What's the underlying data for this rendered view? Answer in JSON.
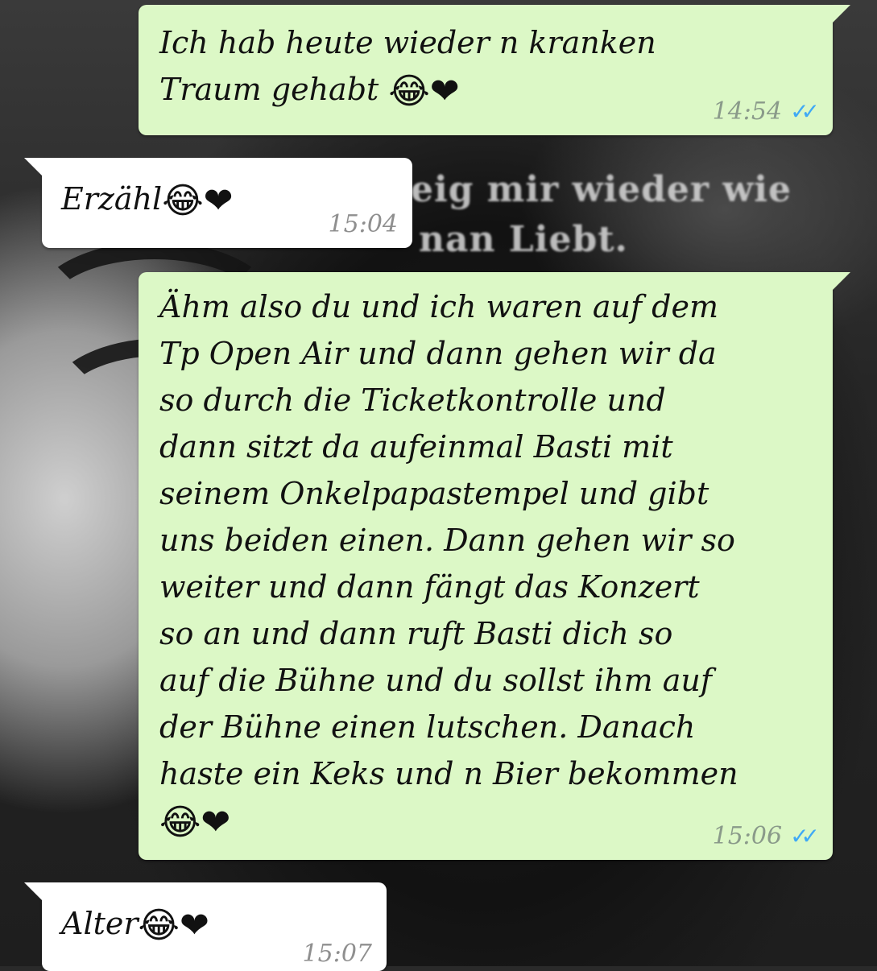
{
  "wallpaper": {
    "caption_line1": "eig mir wieder wie",
    "caption_line2": "nan Liebt."
  },
  "messages": [
    {
      "direction": "outgoing",
      "text": "Ich hab heute wieder n kranken\nTraum gehabt ",
      "emojis": "😂❤",
      "time": "14:54",
      "status": "read"
    },
    {
      "direction": "incoming",
      "text": "Erzähl",
      "emojis": "😂❤",
      "time": "15:04"
    },
    {
      "direction": "outgoing",
      "text": "Ähm also du und ich waren auf dem\nTp Open Air und dann gehen wir da\nso durch die Ticketkontrolle und\ndann sitzt da aufeinmal Basti mit\nseinem Onkelpapastempel und gibt\nuns beiden einen. Dann gehen wir so\nweiter und dann fängt das Konzert\nso an und dann ruft Basti dich so\nauf die Bühne und du sollst ihm auf\nder Bühne einen lutschen. Danach\nhaste ein Keks und n Bier bekommen\n",
      "emojis": "😂❤",
      "time": "15:06",
      "status": "read"
    },
    {
      "direction": "incoming",
      "text": "Alter",
      "emojis": "😂❤",
      "time": "15:07"
    }
  ],
  "read_ticks": "✓✓",
  "colors": {
    "outgoing_bubble": "#dcf8c6",
    "incoming_bubble": "#ffffff",
    "read_ticks": "#3fa9f5"
  }
}
